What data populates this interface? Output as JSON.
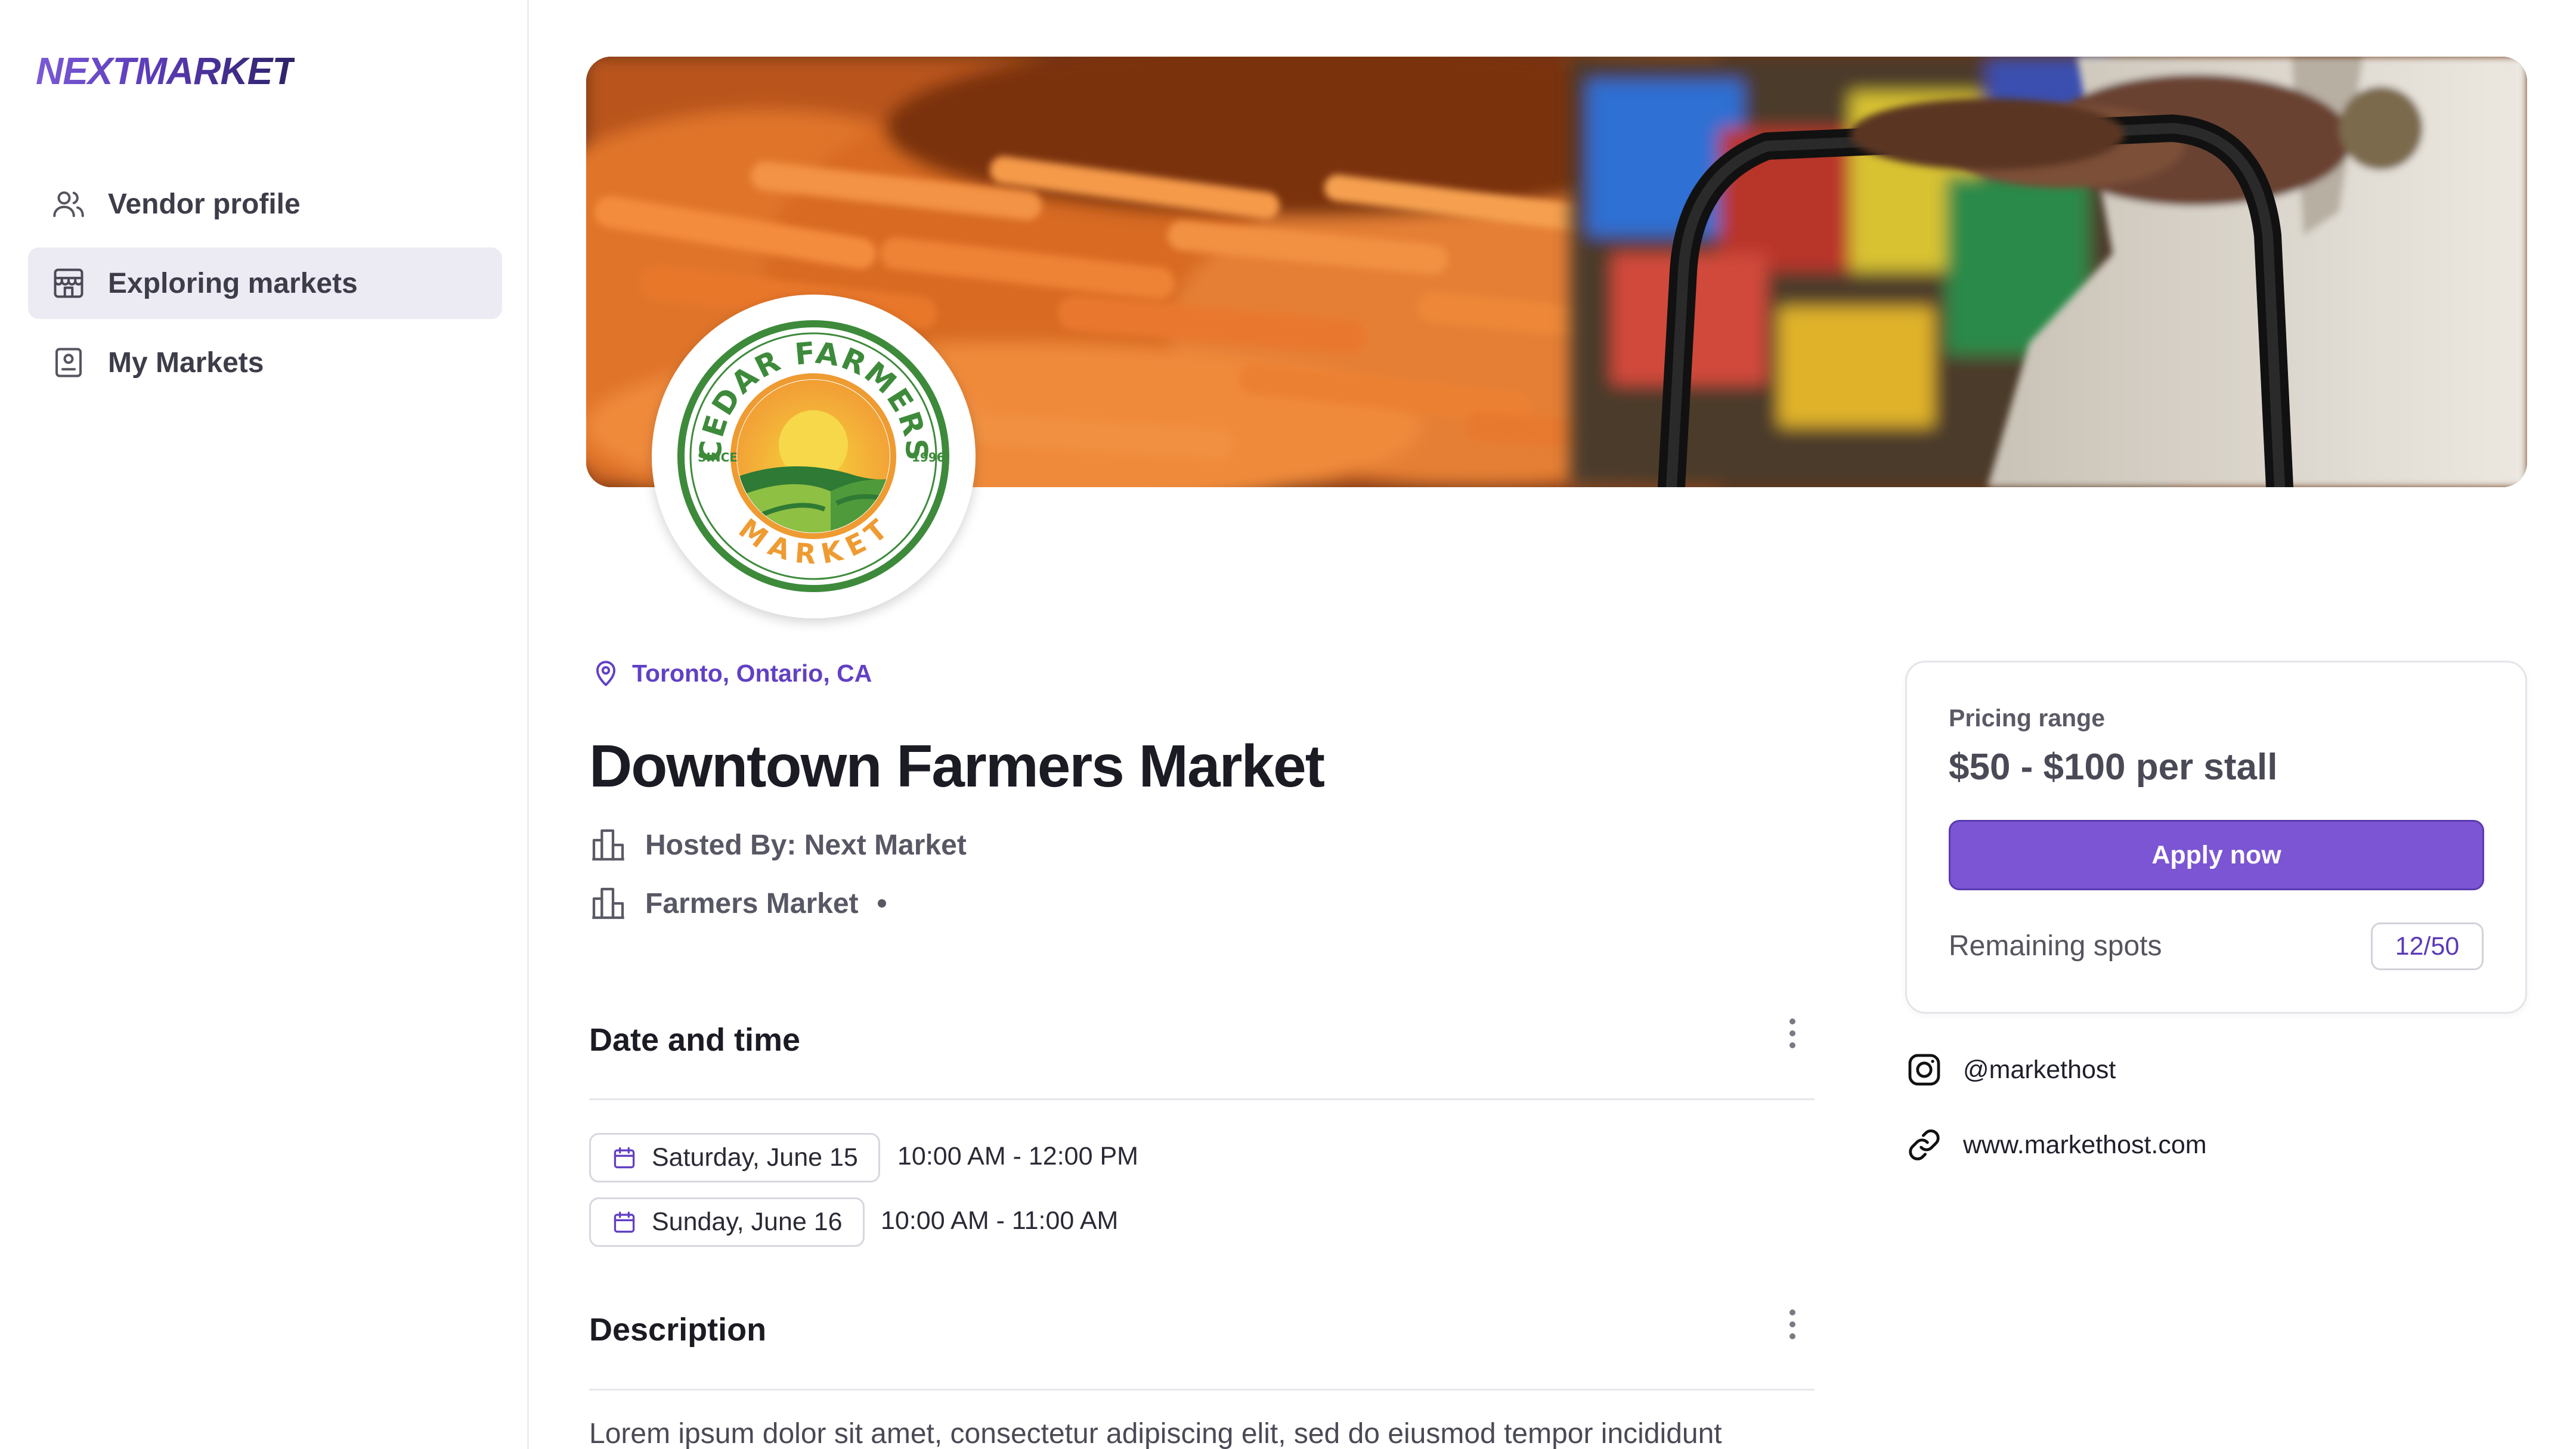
{
  "app": {
    "logo": "NEXTMARKET"
  },
  "sidebar": {
    "items": [
      {
        "label": "Vendor profile",
        "icon": "user-icon",
        "active": false
      },
      {
        "label": "Exploring markets",
        "icon": "store-icon",
        "active": true
      },
      {
        "label": "My Markets",
        "icon": "badge-icon",
        "active": false
      }
    ]
  },
  "market": {
    "logo_text": {
      "top": "CEDAR FARMERS",
      "bottom": "MARKET",
      "left": "SINCE",
      "right": "1996"
    },
    "location": "Toronto, Ontario, CA",
    "title": "Downtown Farmers Market",
    "hosted_by": "Hosted By: Next Market",
    "category": "Farmers Market"
  },
  "sections": {
    "date_time": {
      "title": "Date and time",
      "entries": [
        {
          "date": "Saturday, June 15",
          "time": "10:00 AM - 12:00 PM"
        },
        {
          "date": "Sunday, June 16",
          "time": "10:00 AM - 11:00 AM"
        }
      ]
    },
    "description": {
      "title": "Description",
      "text": "Lorem ipsum dolor sit amet, consectetur adipiscing elit, sed do eiusmod tempor incididunt"
    }
  },
  "pricing": {
    "label": "Pricing range",
    "value": "$50 - $100 per stall",
    "apply_label": "Apply now",
    "remaining_label": "Remaining spots",
    "remaining_value": "12/50"
  },
  "social": {
    "instagram": "@markethost",
    "website": "www.markethost.com"
  },
  "colors": {
    "accent": "#7b55d3",
    "accent_text": "#6140c4",
    "active_nav_bg": "#ecebf4"
  }
}
